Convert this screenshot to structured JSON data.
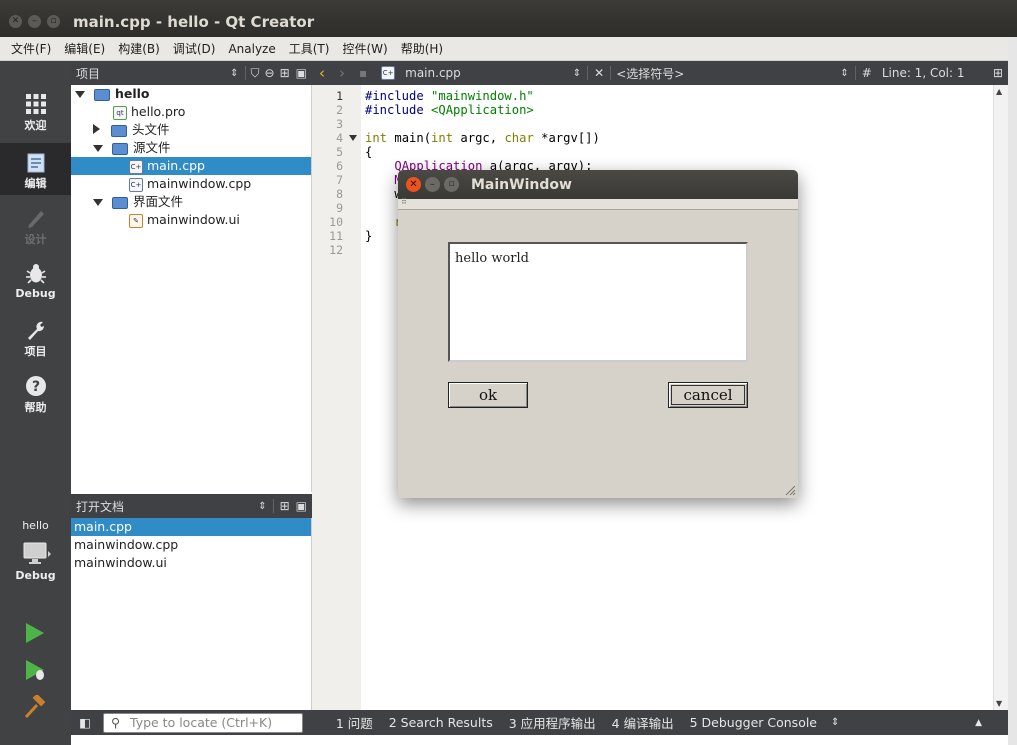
{
  "window": {
    "title": "main.cpp - hello - Qt Creator",
    "controls": [
      "✕",
      "–",
      "▫"
    ]
  },
  "menu": [
    "文件(F)",
    "编辑(E)",
    "构建(B)",
    "调试(D)",
    "Analyze",
    "工具(T)",
    "控件(W)",
    "帮助(H)"
  ],
  "modes": {
    "welcome": "欢迎",
    "edit": "编辑",
    "design": "设计",
    "debug": "Debug",
    "projects": "项目",
    "help": "帮助"
  },
  "kit": {
    "project": "hello",
    "config": "Debug"
  },
  "project_pane": {
    "title": "项目",
    "tree": {
      "root": "hello",
      "pro": "hello.pro",
      "headers": "头文件",
      "sources": "源文件",
      "source_files": [
        "main.cpp",
        "mainwindow.cpp"
      ],
      "forms": "界面文件",
      "form_files": [
        "mainwindow.ui"
      ]
    }
  },
  "open_docs": {
    "title": "打开文档",
    "items": [
      "main.cpp",
      "mainwindow.cpp",
      "mainwindow.ui"
    ]
  },
  "editor_bar": {
    "file": "main.cpp",
    "symbol": "<选择符号>",
    "hash": "#",
    "position": "Line: 1, Col: 1"
  },
  "editor": {
    "line_numbers": [
      "1",
      "2",
      "3",
      "4",
      "5",
      "6",
      "7",
      "8",
      "9",
      "10",
      "11",
      "12"
    ],
    "lines": {
      "l1_a": "#include ",
      "l1_b": "\"mainwindow.h\"",
      "l2_a": "#include ",
      "l2_b": "<QApplication>",
      "l4_a": "int",
      "l4_b": " main(",
      "l4_c": "int",
      "l4_d": " argc, ",
      "l4_e": "char",
      "l4_f": " *argv[])",
      "l5": "{",
      "l6_a": "    ",
      "l6_b": "QApplication",
      "l6_c": " a(argc, argv);",
      "l7": "    M",
      "l8": "    w",
      "l10": "    r",
      "l11": "}"
    }
  },
  "locator": {
    "placeholder": "Type to locate (Ctrl+K)"
  },
  "output_tabs": [
    "1  问题",
    "2  Search Results",
    "3  应用程序输出",
    "4  编译输出",
    "5  Debugger Console"
  ],
  "dialog": {
    "title": "MainWindow",
    "text": "hello world",
    "ok": "ok",
    "cancel": "cancel"
  },
  "colors": {
    "selection": "#308cc6",
    "close_button": "#e95420",
    "mode_bar": "#404244"
  }
}
